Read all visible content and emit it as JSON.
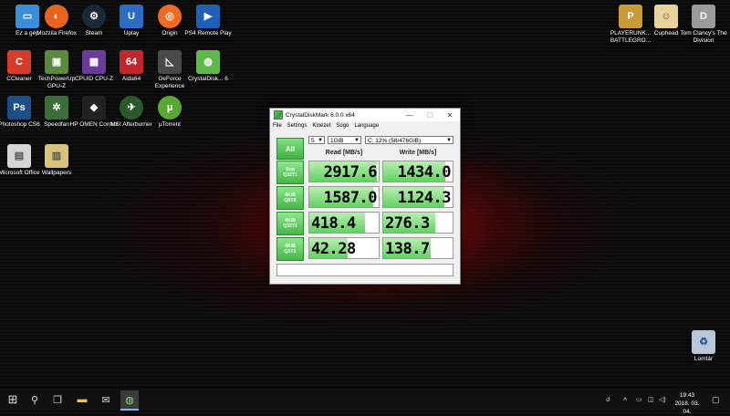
{
  "desktop_icons": {
    "this_pc": {
      "label": "Ez a gép",
      "color": "#3a8fd8",
      "glyph": "▭"
    },
    "firefox": {
      "label": "Mozzila Firefox",
      "color": "#e8641c",
      "glyph": "◐"
    },
    "steam": {
      "label": "Steam",
      "color": "#1b2838",
      "glyph": "⚙"
    },
    "uplay": {
      "label": "Uplay",
      "color": "#2b6cc4",
      "glyph": "U"
    },
    "origin": {
      "label": "Origin",
      "color": "#f06a22",
      "glyph": "◎"
    },
    "ps4": {
      "label": "PS4 Remote Play",
      "color": "#1f5fb8",
      "glyph": "▶"
    },
    "ccleaner": {
      "label": "CCleaner",
      "color": "#d93b2b",
      "glyph": "C"
    },
    "techpowerup": {
      "label": "TechPowerUp GPU-Z",
      "color": "#5c8a3c",
      "glyph": "▣"
    },
    "cpuz": {
      "label": "CPUID CPU-Z",
      "color": "#6a3c9a",
      "glyph": "▦"
    },
    "aida": {
      "label": "Aida64",
      "color": "#c4262e",
      "glyph": "64"
    },
    "geforce": {
      "label": "GeForce Experience",
      "color": "#4a4a4a",
      "glyph": "◺"
    },
    "crystaldisk": {
      "label": "CrystalDisk... 6",
      "color": "#5fb84a",
      "glyph": "◍"
    },
    "photoshop": {
      "label": "Photoshop CS6",
      "color": "#1c4f8a",
      "glyph": "Ps"
    },
    "speedfan": {
      "label": "Speedfan",
      "color": "#3c6e3c",
      "glyph": "✲"
    },
    "hpomen": {
      "label": "HP OMEN Control",
      "color": "#222222",
      "glyph": "◆"
    },
    "msi": {
      "label": "MSI Afterburner",
      "color": "#2a5a2a",
      "glyph": "✈"
    },
    "utorrent": {
      "label": "µTorrent",
      "color": "#5aa832",
      "glyph": "µ"
    },
    "office": {
      "label": "Microsoft Office",
      "color": "#d5d5d5",
      "glyph": "▤"
    },
    "wallpapers": {
      "label": "Wallpapers",
      "color": "#d8c47a",
      "glyph": "▥"
    },
    "pubg": {
      "label": "PLAYERUNK... BATTLEGRO...",
      "color": "#c89a3a",
      "glyph": "P"
    },
    "cuphead": {
      "label": "Cuphead",
      "color": "#e8d49a",
      "glyph": "☺"
    },
    "division": {
      "label": "Tom Clancy's The Division",
      "color": "#9a9a9a",
      "glyph": "D"
    },
    "recycle": {
      "label": "Lomtár",
      "color": "#b8c8d8",
      "glyph": "♻"
    }
  },
  "window": {
    "title": "CrystalDiskMark 6.0.0 x64",
    "min": "—",
    "max": "☐",
    "close": "✕",
    "menu": [
      "File",
      "Settings",
      "Kinézet",
      "Súgó",
      "Language"
    ],
    "all_button": "All",
    "count_select": "5",
    "size_select": "1GiB",
    "drive_select": "C: 12% (58/476GiB)",
    "read_header": "Read [MB/s]",
    "write_header": "Write [MB/s]",
    "rows": [
      {
        "line1": "Seq",
        "line2": "Q32T1",
        "read": "2917.6",
        "write": "1434.0",
        "read_fill": 0.98,
        "write_fill": 0.9
      },
      {
        "line1": "4KiB",
        "line2": "Q8T8",
        "read": "1587.0",
        "write": "1124.3",
        "read_fill": 0.92,
        "write_fill": 0.88
      },
      {
        "line1": "4KiB",
        "line2": "Q32T1",
        "read": "418.4",
        "write": "276.3",
        "read_fill": 0.8,
        "write_fill": 0.75
      },
      {
        "line1": "4KiB",
        "line2": "Q1T1",
        "read": "42.28",
        "write": "138.7",
        "read_fill": 0.55,
        "write_fill": 0.68
      }
    ]
  },
  "taskbar": {
    "start": "⊞",
    "search": "⚲",
    "taskview": "❐",
    "explorer": "▬",
    "mail": "✉",
    "cdm_active": "◍",
    "tray_people": "☌",
    "tray_up": "˄",
    "tray_battery": "▭",
    "tray_network": "◫",
    "tray_volume": "◁)",
    "time": "19:43",
    "date": "2018. 03. 04.",
    "notifications": "▢"
  }
}
